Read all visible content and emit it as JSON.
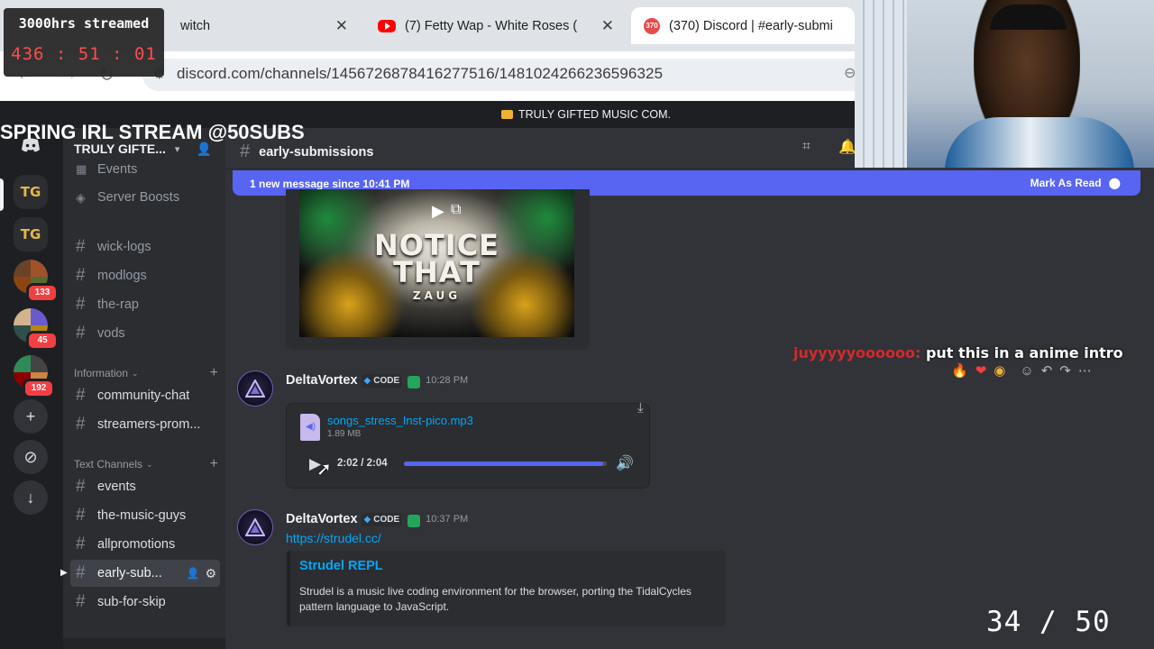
{
  "browser": {
    "tabs": [
      {
        "title": "witch",
        "icon": "twitch-icon"
      },
      {
        "title": "(7) Fetty Wap - White Roses (",
        "icon": "youtube-icon"
      },
      {
        "title": "(370) Discord | #early-submi",
        "icon": "discord-icon",
        "badge": "370",
        "active": true
      }
    ],
    "url": "discord.com/channels/1456726878416277516/1481024266236596325"
  },
  "overlay": {
    "timer_label": "3000hrs streamed",
    "timer_value": "436 : 51 : 01",
    "banner": "SPRING IRL STREAM @50SUBS",
    "counter": "34 / 50",
    "comment_user": "juyyyyyoooooo:",
    "comment_text": "put this in a anime intro"
  },
  "notice": {
    "text": "TRULY GIFTED MUSIC COM."
  },
  "server_rail": {
    "tg_label": "TG",
    "badges": [
      "133",
      "45",
      "192"
    ]
  },
  "sidebar": {
    "guild_name": "TRULY GIFTE...",
    "items_top": [
      {
        "label": "Events",
        "icon": "calendar-icon"
      },
      {
        "label": "Server Boosts",
        "icon": "boost-icon"
      }
    ],
    "channels_a": [
      "wick-logs",
      "modlogs",
      "the-rap",
      "vods"
    ],
    "category_info": "Information",
    "channels_b": [
      "community-chat",
      "streamers-prom..."
    ],
    "category_text": "Text Channels",
    "channels_c": [
      "events",
      "the-music-guys",
      "allpromotions",
      "early-sub...",
      "sub-for-skip"
    ]
  },
  "chat": {
    "channel": "early-submissions",
    "new_messages": "1 new message since 10:41 PM",
    "mark_read": "Mark As Read",
    "video": {
      "line1": "NOTICE",
      "line2": "THAT",
      "line3": "ZAUG"
    },
    "messages": [
      {
        "username": "DeltaVortex",
        "tag": "CODE",
        "time": "10:28 PM",
        "attachment": {
          "name": "songs_stress_Inst-pico.mp3",
          "size": "1.89 MB",
          "time": "2:02 / 2:04",
          "progress": 0.98
        }
      },
      {
        "username": "DeltaVortex",
        "tag": "CODE",
        "time": "10:37 PM",
        "link": "https://strudel.cc/",
        "embed": {
          "title": "Strudel REPL",
          "description": "Strudel is a music live coding environment for the browser, porting the TidalCycles pattern language to JavaScript."
        }
      }
    ]
  },
  "colors": {
    "blurple": "#5865f2",
    "link": "#00a8fc",
    "danger": "#f23f43"
  }
}
